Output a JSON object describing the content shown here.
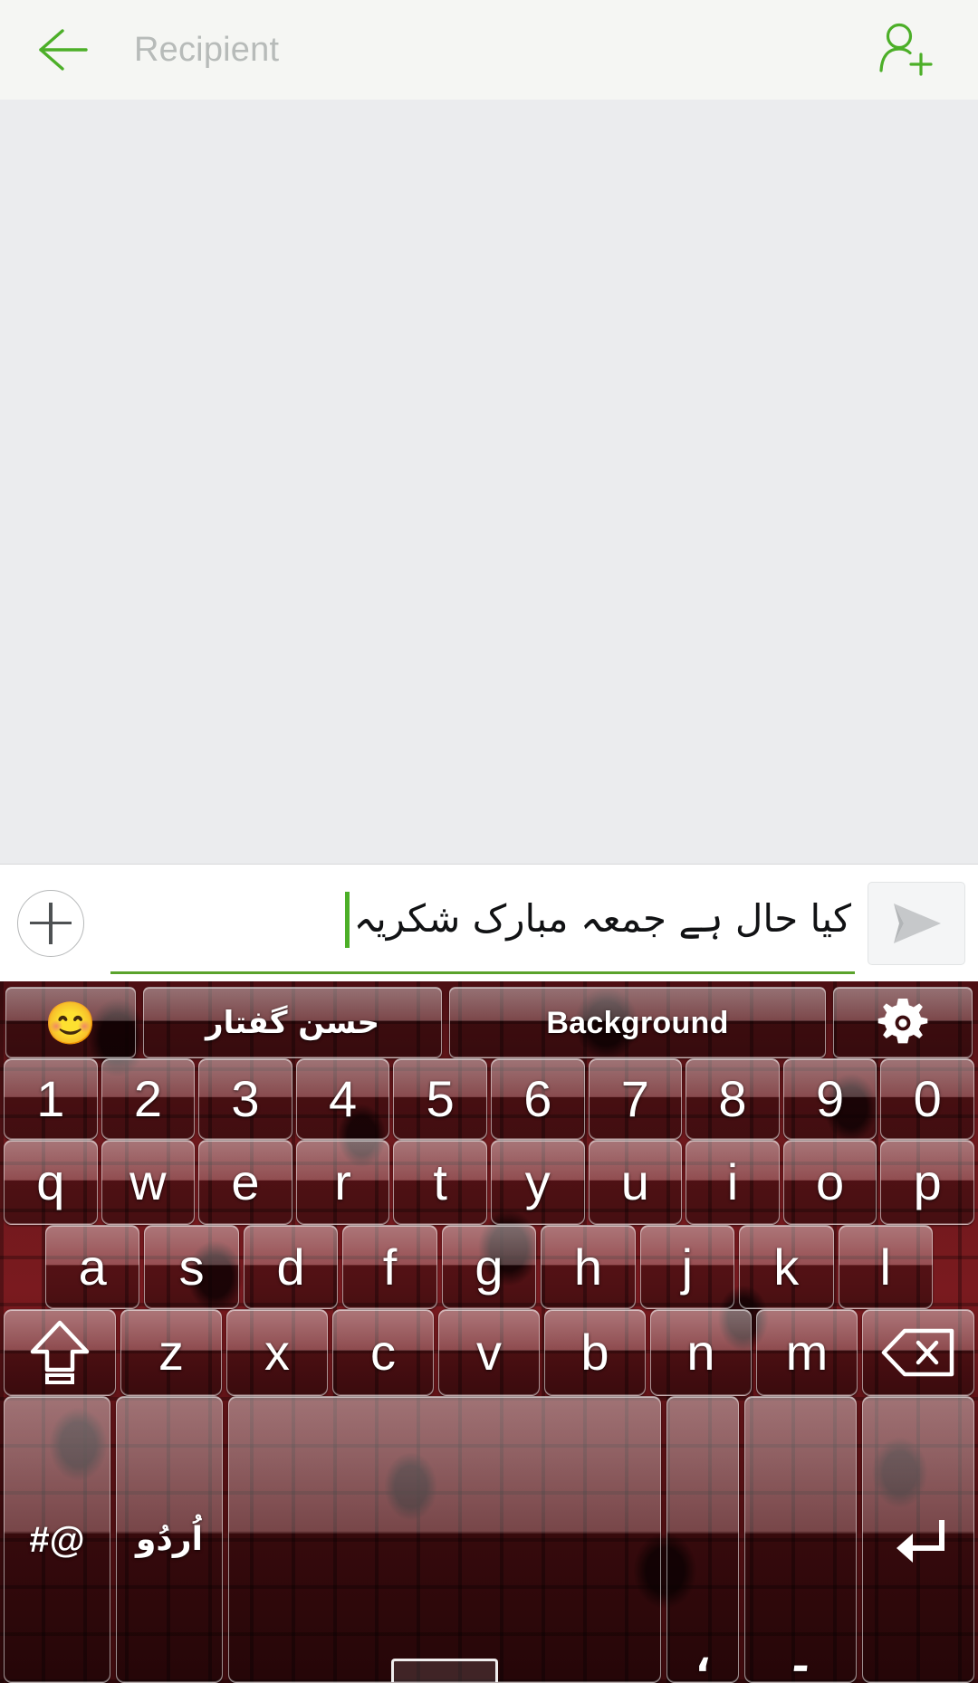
{
  "header": {
    "back_icon": "back-arrow-icon",
    "recipient_placeholder": "Recipient",
    "add_contact_icon": "add-contact-icon",
    "accent_color": "#4caf28",
    "background_color": "#f5f6f3"
  },
  "conversation": {
    "background_color": "#ebecee",
    "messages": []
  },
  "input_bar": {
    "attach_icon": "plus-circle-icon",
    "message_text": "کیا حال ہے جمعہ مبارک شکریہ",
    "message_placeholder": "",
    "caret_color": "#4caf28",
    "underline_color": "#5aa32c",
    "send_icon": "send-arrow-icon",
    "send_button_color": "#f4f5f6"
  },
  "keyboard": {
    "theme_name": "dark-red-damask",
    "background_color": "#5a1216",
    "key_text_color": "#ffffff",
    "toolbar": [
      {
        "name": "emoji-key",
        "label": "😊",
        "icon": "smiley-icon"
      },
      {
        "name": "speech-key",
        "label": "حسن گفتار",
        "icon": ""
      },
      {
        "name": "background-key",
        "label": "Background",
        "icon": ""
      },
      {
        "name": "settings-key",
        "label": "",
        "icon": "gear-icon"
      }
    ],
    "rows": {
      "numbers": [
        "1",
        "2",
        "3",
        "4",
        "5",
        "6",
        "7",
        "8",
        "9",
        "0"
      ],
      "qwerty": [
        "q",
        "w",
        "e",
        "r",
        "t",
        "y",
        "u",
        "i",
        "o",
        "p"
      ],
      "asdf": [
        "a",
        "s",
        "d",
        "f",
        "g",
        "h",
        "j",
        "k",
        "l"
      ],
      "zxcv": [
        "z",
        "x",
        "c",
        "v",
        "b",
        "n",
        "m"
      ]
    },
    "special_keys": {
      "shift": {
        "label": "",
        "icon": "shift-arrow-icon"
      },
      "backspace": {
        "label": "",
        "icon": "backspace-icon"
      },
      "symbols": {
        "label": "#@",
        "icon": ""
      },
      "language": {
        "label": "اُردُو",
        "icon": ""
      },
      "space": {
        "label": "",
        "icon": "spacebar-icon"
      },
      "comma": {
        "label": "،",
        "icon": ""
      },
      "period": {
        "label": "۔",
        "icon": ""
      },
      "enter": {
        "label": "",
        "icon": "enter-return-icon"
      }
    }
  }
}
